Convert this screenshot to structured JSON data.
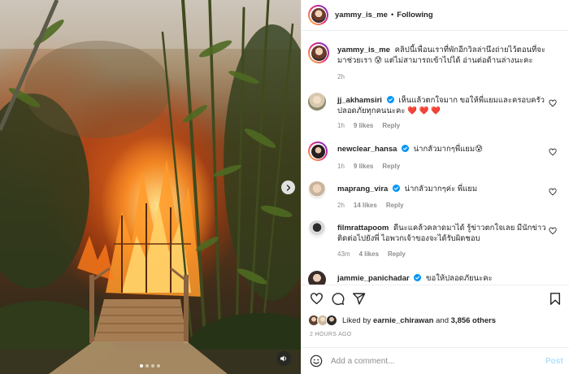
{
  "header": {
    "username": "yammy_is_me",
    "separator": "•",
    "follow_state": "Following"
  },
  "caption": {
    "username": "yammy_is_me",
    "text": "คลิปนี้เพื่อนเราที่พักอีกวิลล่านึงถ่ายไว้ตอนที่จะมาช่วยเรา 😰 แต่ไม่สามารถเข้าไปได้ อ่านต่อด้านล่างนะคะ",
    "time": "2h"
  },
  "comments": [
    {
      "username": "jj_akhamsiri",
      "verified": true,
      "text": "เห็นแล้วตกใจมาก ขอให้พี่แยมและครอบครัวปลอดภัยทุกคนนะคะ ❤️ ❤️ ❤️",
      "time": "1h",
      "likes": "9 likes",
      "reply": "Reply"
    },
    {
      "username": "newclear_hansa",
      "verified": true,
      "text": "น่ากลัวมากๆพี่แยม😰",
      "time": "1h",
      "likes": "9 likes",
      "reply": "Reply"
    },
    {
      "username": "maprang_vira",
      "verified": true,
      "text": "น่ากลัวมากๆค่ะ พี่แยม",
      "time": "2h",
      "likes": "14 likes",
      "reply": "Reply"
    },
    {
      "username": "filmrattapoom",
      "verified": false,
      "text": "ดีนะแคล้วคลาดมาได้ รู้ข่าวตกใจเลย มีนักข่าว ติดต่อไปยังพี่ ไอพวกเจ้าของจะได้รับผิดชอบ",
      "time": "43m",
      "likes": "4 likes",
      "reply": "Reply"
    },
    {
      "username": "jammie_panichadar",
      "verified": true,
      "text": "ขอให้ปลอดภัยนะคะ"
    }
  ],
  "likes": {
    "prefix": "Liked by ",
    "user": "earnie_chirawan",
    "middle": " and ",
    "others": "3,856 others"
  },
  "posted_ago": "2 HOURS AGO",
  "add_comment": {
    "placeholder": "Add a comment...",
    "post_label": "Post"
  },
  "media": {
    "slides": 4,
    "active_slide": 1
  },
  "icons": {
    "next": "chevron-right-icon",
    "sound": "speaker-icon",
    "like": "heart-icon",
    "comment": "comment-bubble-icon",
    "share": "paper-plane-icon",
    "save": "bookmark-icon",
    "emoji": "smiley-icon",
    "verified": "verified-badge-icon"
  },
  "colors": {
    "verified": "#0095f6",
    "post_button": "#b2dffc",
    "secondary_text": "#8e8e8e"
  }
}
